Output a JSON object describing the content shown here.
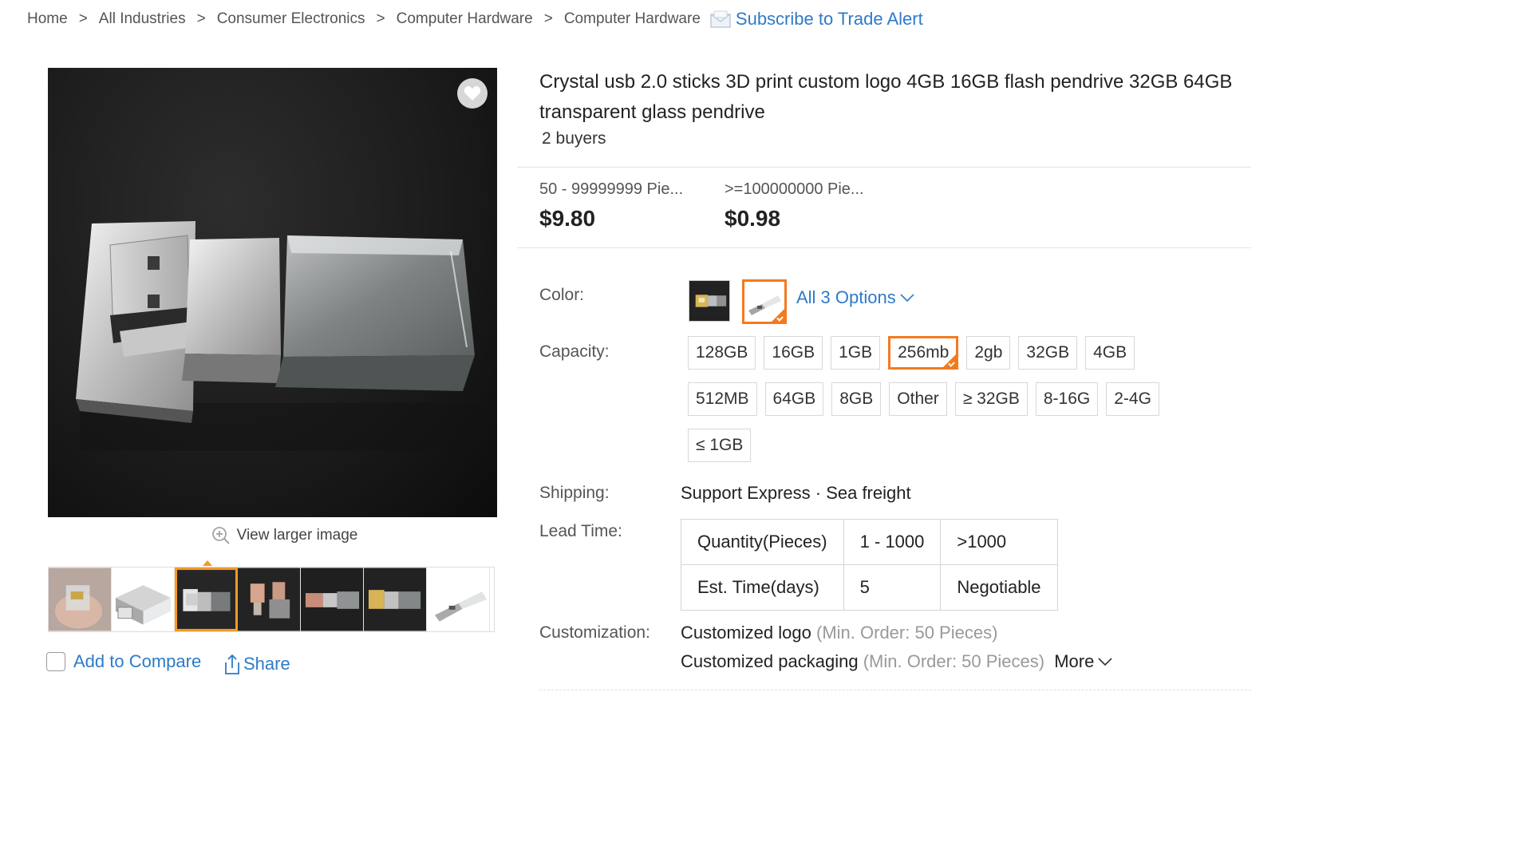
{
  "breadcrumb": {
    "items": [
      "Home",
      "All Industries",
      "Consumer Electronics",
      "Computer Hardware",
      "Computer Hardware"
    ],
    "separator": ">",
    "subscribe_label": "Subscribe to Trade Alert"
  },
  "gallery": {
    "view_larger_label": "View larger image",
    "thumbnail_count": 7,
    "selected_thumbnail": 3,
    "compare_label": "Add to Compare",
    "share_label": "Share"
  },
  "product": {
    "title": "Crystal usb 2.0 sticks 3D print custom logo 4GB 16GB flash pendrive 32GB 64GB transparent glass pendrive",
    "buyers": "2 buyers"
  },
  "pricing": [
    {
      "range": "50 - 99999999 Pie...",
      "price": "$9.80"
    },
    {
      "range": ">=100000000 Pie...",
      "price": "$0.98"
    }
  ],
  "color": {
    "label": "Color:",
    "options_link": "All 3 Options",
    "selected_index": 1
  },
  "capacity": {
    "label": "Capacity:",
    "options": [
      "128GB",
      "16GB",
      "1GB",
      "256mb",
      "2gb",
      "32GB",
      "4GB",
      "512MB",
      "64GB",
      "8GB",
      "Other",
      "≥ 32GB",
      "8-16G",
      "2-4G",
      "≤ 1GB"
    ],
    "selected": "256mb"
  },
  "shipping": {
    "label": "Shipping:",
    "value": "Support Express · Sea freight"
  },
  "lead_time": {
    "label": "Lead Time:",
    "rows": [
      [
        "Quantity(Pieces)",
        "1 - 1000",
        ">1000"
      ],
      [
        "Est. Time(days)",
        "5",
        "Negotiable"
      ]
    ]
  },
  "customization": {
    "label": "Customization:",
    "items": [
      {
        "name": "Customized logo",
        "note": "(Min. Order: 50 Pieces)"
      },
      {
        "name": "Customized packaging",
        "note": "(Min. Order: 50 Pieces)"
      }
    ],
    "more_label": "More"
  },
  "colors": {
    "link": "#2f7ac8",
    "accent": "#f47a20",
    "thumb_accent": "#f59a23"
  }
}
